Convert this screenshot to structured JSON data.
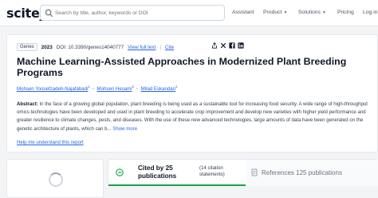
{
  "header": {
    "logo": "scite_",
    "search": {
      "placeholder": "Search by title, author, keywords or DOI"
    },
    "nav": [
      {
        "label": "Assistant",
        "has_dropdown": false
      },
      {
        "label": "Product",
        "has_dropdown": true
      },
      {
        "label": "Solutions",
        "has_dropdown": true
      },
      {
        "label": "Pricing",
        "has_dropdown": false
      },
      {
        "label": "Log in",
        "has_dropdown": false
      }
    ]
  },
  "article": {
    "badge": "Genes",
    "year": "2023",
    "doi": "DOI: 10.3390/genes14040777",
    "view_full_text": "View full text",
    "separator": "|",
    "cite": "Cite",
    "social_icons": [
      "share-icon",
      "twitter-icon",
      "facebook-icon",
      "linkedin-icon"
    ],
    "title": "Machine Learning-Assisted Approaches in Modernized Plant Breeding Programs",
    "authors": [
      {
        "name": "Mohsen Yoosefzadeh-Najafabadi",
        "sup": "1"
      },
      {
        "name": "Mohsen Hesami",
        "sup": "2"
      },
      {
        "name": "Milad Eskandari",
        "sup": "1"
      }
    ],
    "abstract_label": "Abstract:",
    "abstract_text": " In the face of a growing global population, plant breeding is being used as a sustainable tool for increasing food security. A wide range of high-throughput omics technologies have been developed and used in plant breeding to accelerate crop improvement and develop new varieties with higher yield performance and greater resilience to climate changes, pests, and diseases. With the use of these new advanced technologies, large amounts of data have been generated on the genetic architecture of plants, which can b...",
    "show_more": "Show more",
    "help_link": "Help me understand this report"
  },
  "tabs": {
    "cited_by": "Cited by 25 publications",
    "citation_statements": "(14 citation statements)",
    "references": "References 125 publications"
  },
  "colors": {
    "accent": "#2563eb",
    "active_tab": "#16a34a"
  }
}
